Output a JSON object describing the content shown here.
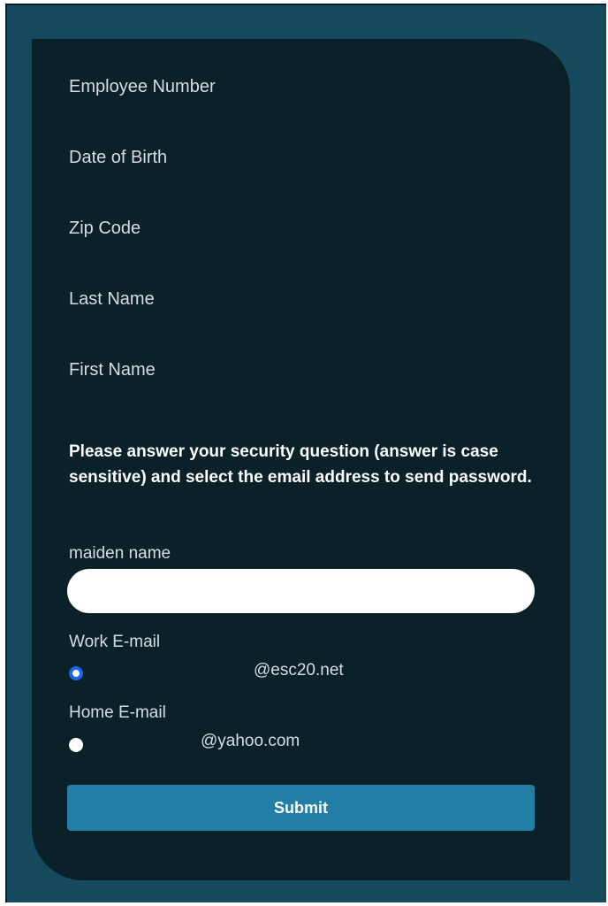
{
  "form": {
    "fields": {
      "employee_number": "Employee Number",
      "date_of_birth": "Date of Birth",
      "zip_code": "Zip Code",
      "last_name": "Last Name",
      "first_name": "First Name"
    },
    "instructions": "Please answer your security question (answer is case sensitive) and select the email address to send password.",
    "security_question": {
      "label": "maiden name",
      "value": "",
      "placeholder": ""
    },
    "email_options": [
      {
        "label": "Work E-mail",
        "address": "@esc20.net",
        "selected": true
      },
      {
        "label": "Home E-mail",
        "address": "@yahoo.com",
        "selected": false
      }
    ],
    "submit_label": "Submit"
  },
  "colors": {
    "background": "#164a5e",
    "card": "#0b212a",
    "button": "#237ea6",
    "radio_selected": "#1a64e6"
  }
}
